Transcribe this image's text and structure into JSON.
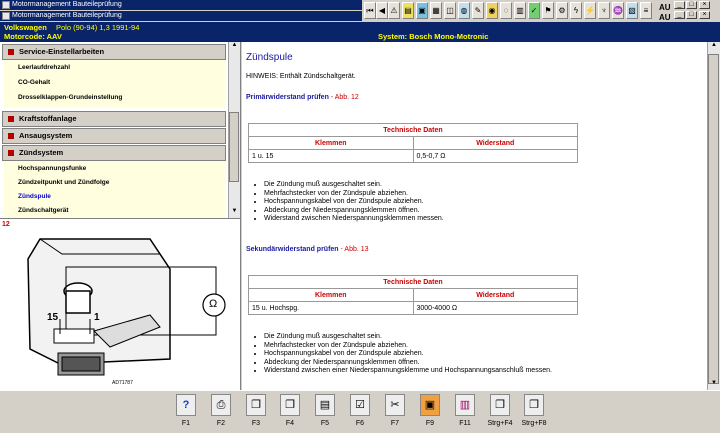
{
  "window": {
    "title1": "Motormanagement Bauteileprüfung",
    "title2": "Motormanagement Bauteileprüfung",
    "toolbar_label_au1": "AU",
    "toolbar_label_au2": "AU"
  },
  "vehicle": {
    "make": "Volkswagen",
    "model": "Polo (90-94) 1,3   1991-94",
    "motor": "Motorcode: AAV",
    "system": "System: Bosch Mono-Motronic"
  },
  "sidebar": {
    "sections": [
      {
        "title": "Service-Einstellarbeiten",
        "items": [
          "Leerlaufdrehzahl",
          "CO-Gehalt",
          "Drosselklappen-Grundeinstellung"
        ]
      },
      {
        "title": "Kraftstoffanlage",
        "items": []
      },
      {
        "title": "Ansaugsystem",
        "items": []
      },
      {
        "title": "Zündsystem",
        "items": [
          "Hochspannungsfunke",
          "Zündzeitpunkt und Zündfolge",
          "Zündspule",
          "Zündschaltgerät"
        ]
      }
    ],
    "active_item": "Zündspule"
  },
  "figure": {
    "number": "12",
    "label_15": "15",
    "label_1": "1",
    "ohm": "Ω",
    "code": "AD71787"
  },
  "content": {
    "title": "Zündspule",
    "hint": "HINWEIS: Enthält Zündschaltgerät.",
    "primary": {
      "heading": "Primärwiderstand prüfen",
      "fig_ref": " - Abb. 12",
      "table_title": "Technische Daten",
      "col1": "Klemmen",
      "col2": "Widerstand",
      "row_klemmen": "1 u. 15",
      "row_widerstand": "0,5-0,7 Ω",
      "steps": [
        "Die Zündung muß ausgeschaltet sein.",
        "Mehrfachstecker von der Zündspule abziehen.",
        "Hochspannungskabel von der Zündspule abziehen.",
        "Abdeckung der Niederspannungsklemmen öffnen.",
        "Widerstand zwischen Niederspannungsklemmen messen."
      ]
    },
    "secondary": {
      "heading": "Sekundärwiderstand prüfen",
      "fig_ref": " - Abb. 13",
      "table_title": "Technische Daten",
      "col1": "Klemmen",
      "col2": "Widerstand",
      "row_klemmen": "15 u. Hochspg.",
      "row_widerstand": "3000-4000 Ω",
      "steps": [
        "Die Zündung muß ausgeschaltet sein.",
        "Mehrfachstecker von der Zündspule abziehen.",
        "Hochspannungskabel von der Zündspule abziehen.",
        "Abdeckung der Niederspannungsklemmen öffnen.",
        "Widerstand zwischen einer Niederspannungsklemme und Hochspannungsanschluß messen."
      ]
    }
  },
  "function_keys": [
    {
      "label": "F1",
      "icon": "help-icon"
    },
    {
      "label": "F2",
      "icon": "print-icon"
    },
    {
      "label": "F3",
      "icon": "pages-icon"
    },
    {
      "label": "F4",
      "icon": "pages-icon"
    },
    {
      "label": "F5",
      "icon": "document-icon"
    },
    {
      "label": "F6",
      "icon": "doc-check-icon"
    },
    {
      "label": "F7",
      "icon": "tools-icon"
    },
    {
      "label": "F9",
      "icon": "component-icon"
    },
    {
      "label": "F11",
      "icon": "diagram-icon"
    },
    {
      "label": "Strg+F4",
      "icon": "pages-icon"
    },
    {
      "label": "Strg+F8",
      "icon": "pages-icon"
    }
  ],
  "colors": {
    "title_bar": "#0a246a",
    "header_text": "#ffff00",
    "heading_blue": "#1a1aa0",
    "table_red": "#cc0000"
  }
}
